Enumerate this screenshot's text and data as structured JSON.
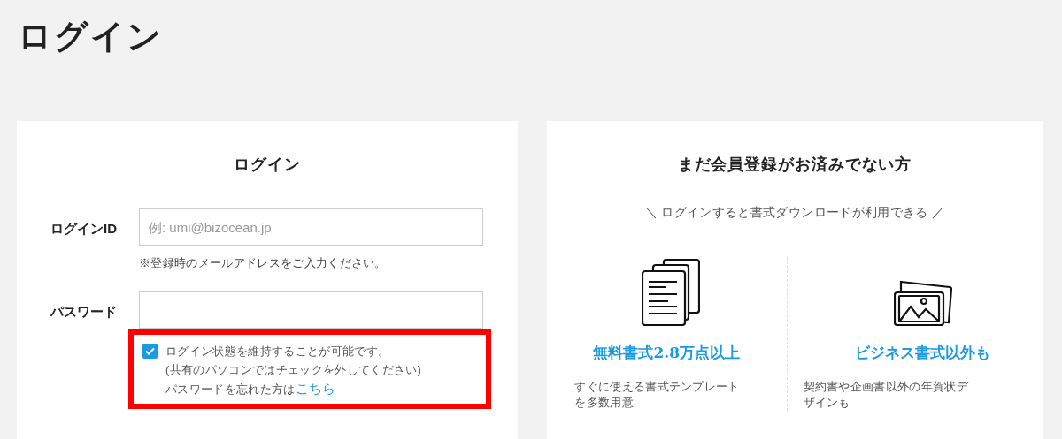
{
  "page_title": "ログイン",
  "login": {
    "heading": "ログイン",
    "fields": [
      {
        "label": "ログインID",
        "placeholder": "例: umi@bizocean.jp",
        "hint": "※登録時のメールアドレスをご入力ください。"
      },
      {
        "label": "パスワード"
      }
    ],
    "remember": {
      "checked": true,
      "text": "ログイン状態を維持することが可能です。",
      "note": "(共有のパソコンではチェックを外してください)"
    },
    "forgot": {
      "text": "パスワードを忘れた方は",
      "link": "こちら"
    }
  },
  "signup": {
    "heading": "まだ会員登録がお済みでない方",
    "tagline": "＼ ログインすると書式ダウンロードが利用できる ／",
    "features": [
      {
        "kind": "documents",
        "title": "無料書式2.8万点以上",
        "lines": [
          "すぐに使える書式テンプレート",
          "を多数用意"
        ]
      },
      {
        "kind": "images",
        "title": "ビジネス書式以外も",
        "lines": [
          "契約書や企画書以外の年賀状デ",
          "ザインも"
        ]
      }
    ]
  }
}
